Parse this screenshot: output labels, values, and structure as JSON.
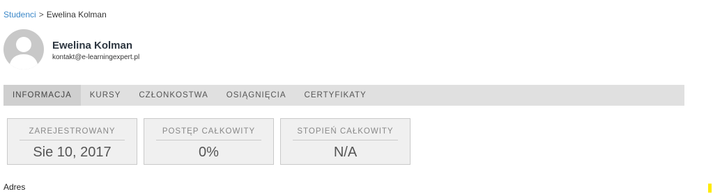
{
  "breadcrumb": {
    "parent": "Studenci",
    "separator": ">",
    "current": "Ewelina Kolman"
  },
  "profile": {
    "name": "Ewelina Kolman",
    "email": "kontakt@e-learningexpert.pl"
  },
  "tabs": [
    {
      "label": "INFORMACJA",
      "active": true
    },
    {
      "label": "KURSY"
    },
    {
      "label": "CZŁONKOSTWA"
    },
    {
      "label": "OSIĄGNIĘCIA"
    },
    {
      "label": "CERTYFIKATY"
    }
  ],
  "stats": [
    {
      "label": "ZAREJESTROWANY",
      "value": "Sie 10, 2017"
    },
    {
      "label": "POSTĘP CAŁKOWITY",
      "value": "0%"
    },
    {
      "label": "STOPIEŃ CAŁKOWITY",
      "value": "N/A"
    }
  ],
  "section": {
    "title": "Adres"
  },
  "colors": {
    "link": "#3a87c8",
    "tab_bar": "#e0e0e0",
    "tab_active": "#cfcfcf",
    "card_bg": "#f0f0f0"
  }
}
